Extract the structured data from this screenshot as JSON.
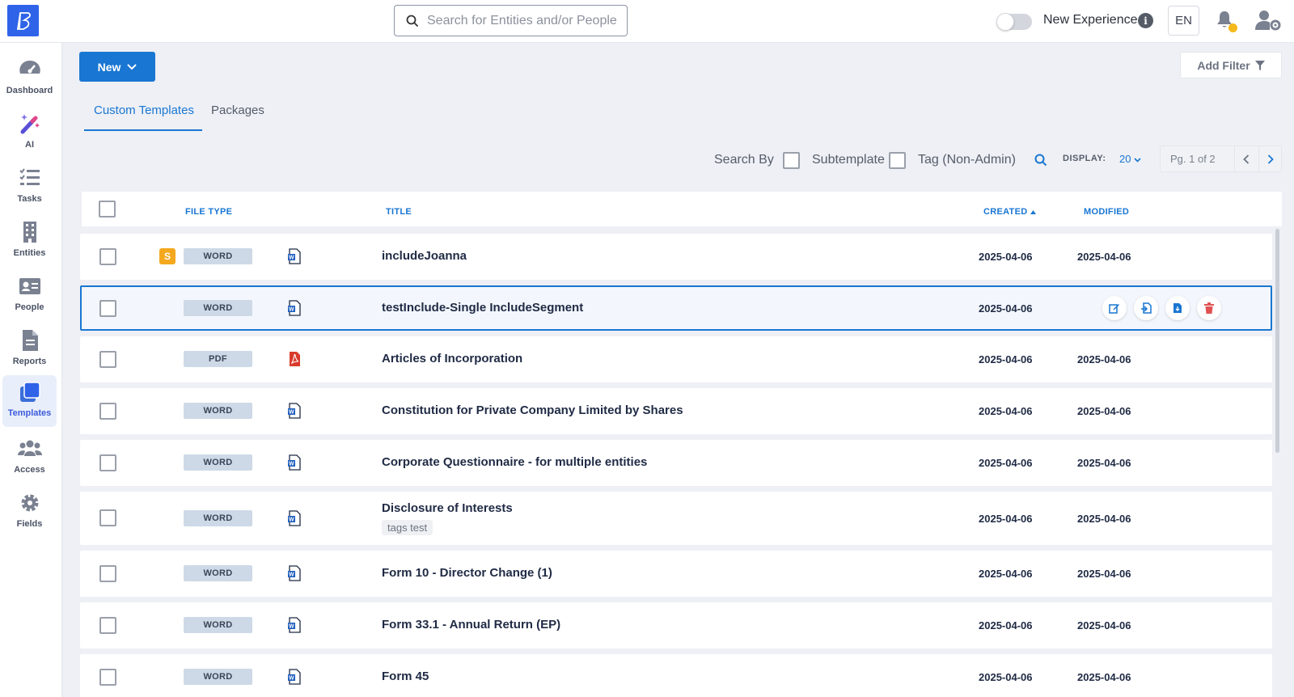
{
  "header": {
    "search_placeholder": "Search for Entities and/or People",
    "new_experience_label": "New Experience",
    "language": "EN"
  },
  "sidebar": {
    "items": [
      {
        "label": "Dashboard",
        "icon": "dashboard-gauge-icon"
      },
      {
        "label": "AI",
        "icon": "magic-wand-icon"
      },
      {
        "label": "Tasks",
        "icon": "task-list-icon"
      },
      {
        "label": "Entities",
        "icon": "building-icon"
      },
      {
        "label": "People",
        "icon": "id-card-icon"
      },
      {
        "label": "Reports",
        "icon": "report-document-icon"
      },
      {
        "label": "Templates",
        "icon": "templates-stack-icon",
        "active": true
      },
      {
        "label": "Access",
        "icon": "users-group-icon"
      },
      {
        "label": "Fields",
        "icon": "gear-icon"
      }
    ]
  },
  "toolbar": {
    "new_label": "New",
    "add_filter_label": "Add Filter"
  },
  "tabs": {
    "custom": "Custom Templates",
    "packages": "Packages"
  },
  "search_by": {
    "label": "Search By",
    "subtemplate": "Subtemplate",
    "tag": "Tag (Non-Admin)"
  },
  "display": {
    "label": "DISPLAY:",
    "value": "20"
  },
  "pager": {
    "text": "Pg. 1 of 2"
  },
  "table": {
    "columns": {
      "file_type": "FILE TYPE",
      "title": "TITLE",
      "created": "CREATED",
      "modified": "MODIFIED"
    },
    "rows": [
      {
        "type": "WORD",
        "title": "includeJoanna",
        "created": "2025-04-06",
        "modified": "2025-04-06",
        "subtemplate_badge": "S"
      },
      {
        "type": "WORD",
        "title": "testInclude-Single IncludeSegment",
        "created": "2025-04-06",
        "modified": "",
        "selected": true
      },
      {
        "type": "PDF",
        "title": "Articles of Incorporation",
        "created": "2025-04-06",
        "modified": "2025-04-06"
      },
      {
        "type": "WORD",
        "title": "Constitution for Private Company Limited by Shares",
        "created": "2025-04-06",
        "modified": "2025-04-06"
      },
      {
        "type": "WORD",
        "title": "Corporate Questionnaire - for multiple entities",
        "created": "2025-04-06",
        "modified": "2025-04-06"
      },
      {
        "type": "WORD",
        "title": "Disclosure of Interests",
        "tag": "tags test",
        "created": "2025-04-06",
        "modified": "2025-04-06"
      },
      {
        "type": "WORD",
        "title": "Form 10 - Director Change (1)",
        "created": "2025-04-06",
        "modified": "2025-04-06"
      },
      {
        "type": "WORD",
        "title": "Form 33.1 - Annual Return (EP)",
        "created": "2025-04-06",
        "modified": "2025-04-06"
      },
      {
        "type": "WORD",
        "title": "Form 45",
        "created": "2025-04-06",
        "modified": "2025-04-06"
      }
    ]
  },
  "colors": {
    "accent": "#1976d2",
    "badge": "#f4a81d",
    "notification_dot": "#f6b91a",
    "delete": "#e05252"
  }
}
